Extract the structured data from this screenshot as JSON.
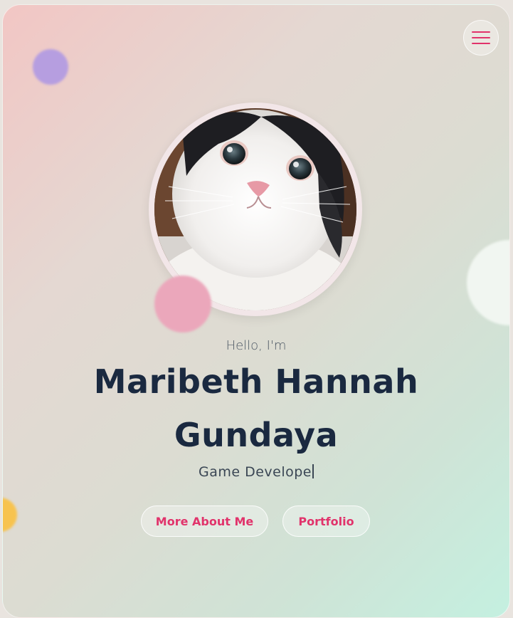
{
  "hero": {
    "greeting": "Hello, I'm",
    "name_line_1": "Maribeth Hannah",
    "name_line_2": "Gundaya",
    "role_typed": "Game Develope"
  },
  "menu": {
    "icon": "hamburger-menu-icon"
  },
  "avatar": {
    "subject": "white and black cat photo"
  },
  "buttons": {
    "about_label": "More About Me",
    "portfolio_label": "Portfolio"
  },
  "colors": {
    "accent": "#e1336b",
    "name_text": "#1a2940",
    "bg_top_left": "#f2c6c4",
    "bg_bottom_right": "#c4f0e0",
    "blob_purple": "#b69ee0",
    "blob_pink": "#eba7bb",
    "blob_orange": "#f7c34f"
  }
}
